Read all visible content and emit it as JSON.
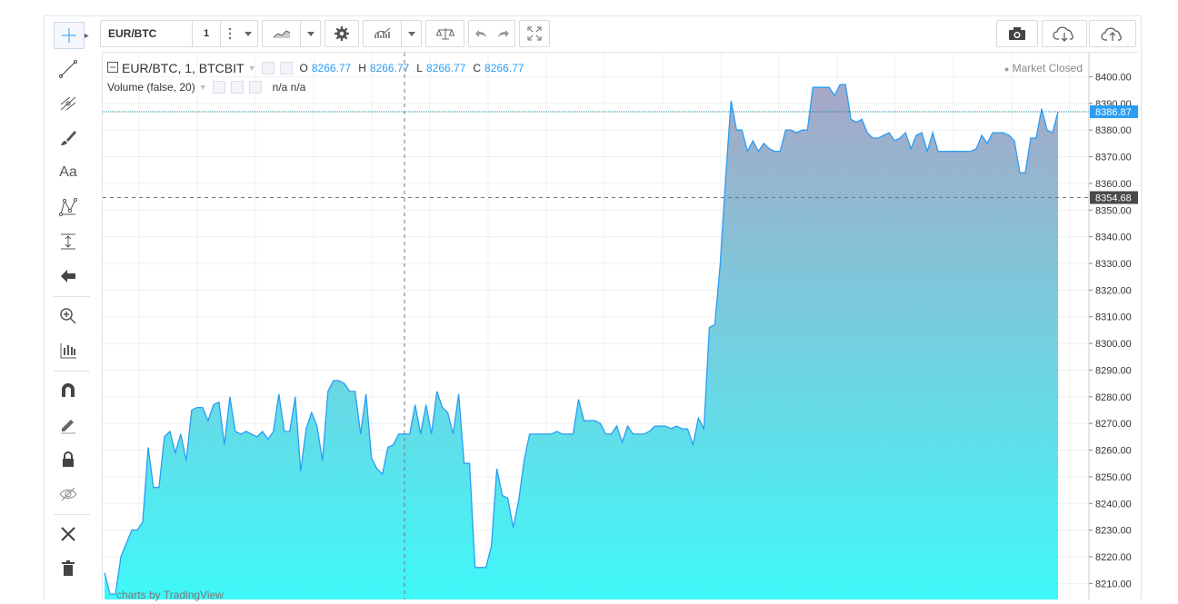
{
  "toolbar": {
    "symbol": "EUR/BTC",
    "interval": "1"
  },
  "legend": {
    "main": {
      "title": "EUR/BTC, 1, BTCBIT",
      "o_label": "O",
      "o_value": "8266.77",
      "h_label": "H",
      "h_value": "8266.77",
      "l_label": "L",
      "l_value": "8266.77",
      "c_label": "C",
      "c_value": "8266.77"
    },
    "volume": {
      "title": "Volume (false, 20)",
      "values": "n/a n/a"
    }
  },
  "market_status": "Market Closed",
  "watermark": "charts by TradingView",
  "left_tools": [
    "crosshair-icon",
    "trend-line-icon",
    "fib-icon",
    "brush-icon",
    "text-icon",
    "pattern-icon",
    "measure-icon",
    "back-arrow-icon",
    "zoom-icon",
    "bars-icon",
    "magnet-icon",
    "pencil-icon",
    "lock-icon",
    "eye-off-icon",
    "tools-icon",
    "trash-icon"
  ],
  "colors": {
    "line": "#2a9df4",
    "fill_top": "#a7a7c6",
    "fill_bottom": "#3ff8f9",
    "last_price_bg": "#2a9df4",
    "crosshair_label_bg": "#4a4a4a"
  },
  "chart_data": {
    "type": "area",
    "ylim": [
      8204,
      8409
    ],
    "y_ticks": [
      "8400.00",
      "8390.00",
      "8380.00",
      "8370.00",
      "8360.00",
      "8350.00",
      "8340.00",
      "8330.00",
      "8320.00",
      "8310.00",
      "8300.00",
      "8290.00",
      "8280.00",
      "8270.00",
      "8260.00",
      "8250.00",
      "8240.00",
      "8230.00",
      "8220.00",
      "8210.00"
    ],
    "last_price_label": "8386.87",
    "last_price": 8386.87,
    "crosshair_price_label": "8354.68",
    "crosshair_price": 8354.68,
    "values": [
      8214,
      8206,
      8206,
      8220,
      8225,
      8230,
      8230,
      8233,
      8261,
      8246,
      8246,
      8265,
      8267,
      8259,
      8266,
      8256,
      8275,
      8276,
      8276,
      8271,
      8277,
      8278,
      8262,
      8280,
      8267,
      8266,
      8267,
      8266,
      8265,
      8267,
      8264,
      8267,
      8281,
      8267,
      8267,
      8280,
      8252,
      8268,
      8274,
      8269,
      8256,
      8282,
      8286,
      8286,
      8285,
      8282,
      8282,
      8266,
      8281,
      8257,
      8253,
      8251,
      8261,
      8262,
      8266,
      8266,
      8266,
      8277,
      8266,
      8277,
      8266,
      8282,
      8276,
      8274,
      8266,
      8281,
      8255,
      8255,
      8216,
      8216,
      8216,
      8224,
      8253,
      8243,
      8242,
      8231,
      8241,
      8256,
      8266,
      8266,
      8266,
      8266,
      8266,
      8267,
      8266,
      8266,
      8266,
      8279,
      8271,
      8271,
      8271,
      8270,
      8266,
      8266,
      8269,
      8263,
      8269,
      8266,
      8266,
      8266,
      8267,
      8269,
      8269,
      8269,
      8268,
      8269,
      8268,
      8268,
      8262,
      8272,
      8268,
      8306,
      8307,
      8330,
      8362,
      8391,
      8380,
      8380,
      8372,
      8376,
      8372,
      8375,
      8373,
      8372,
      8372,
      8380,
      8380,
      8379,
      8380,
      8380,
      8396,
      8396,
      8396,
      8396,
      8393,
      8397,
      8397,
      8384,
      8383,
      8384,
      8379,
      8377,
      8377,
      8378,
      8379,
      8376,
      8377,
      8379,
      8373,
      8378,
      8379,
      8372,
      8379,
      8372,
      8372,
      8372,
      8372,
      8372,
      8372,
      8372,
      8373,
      8378,
      8375,
      8379,
      8379,
      8379,
      8378,
      8376,
      8364,
      8364,
      8377,
      8377,
      8388,
      8380,
      8379,
      8386.87
    ]
  }
}
